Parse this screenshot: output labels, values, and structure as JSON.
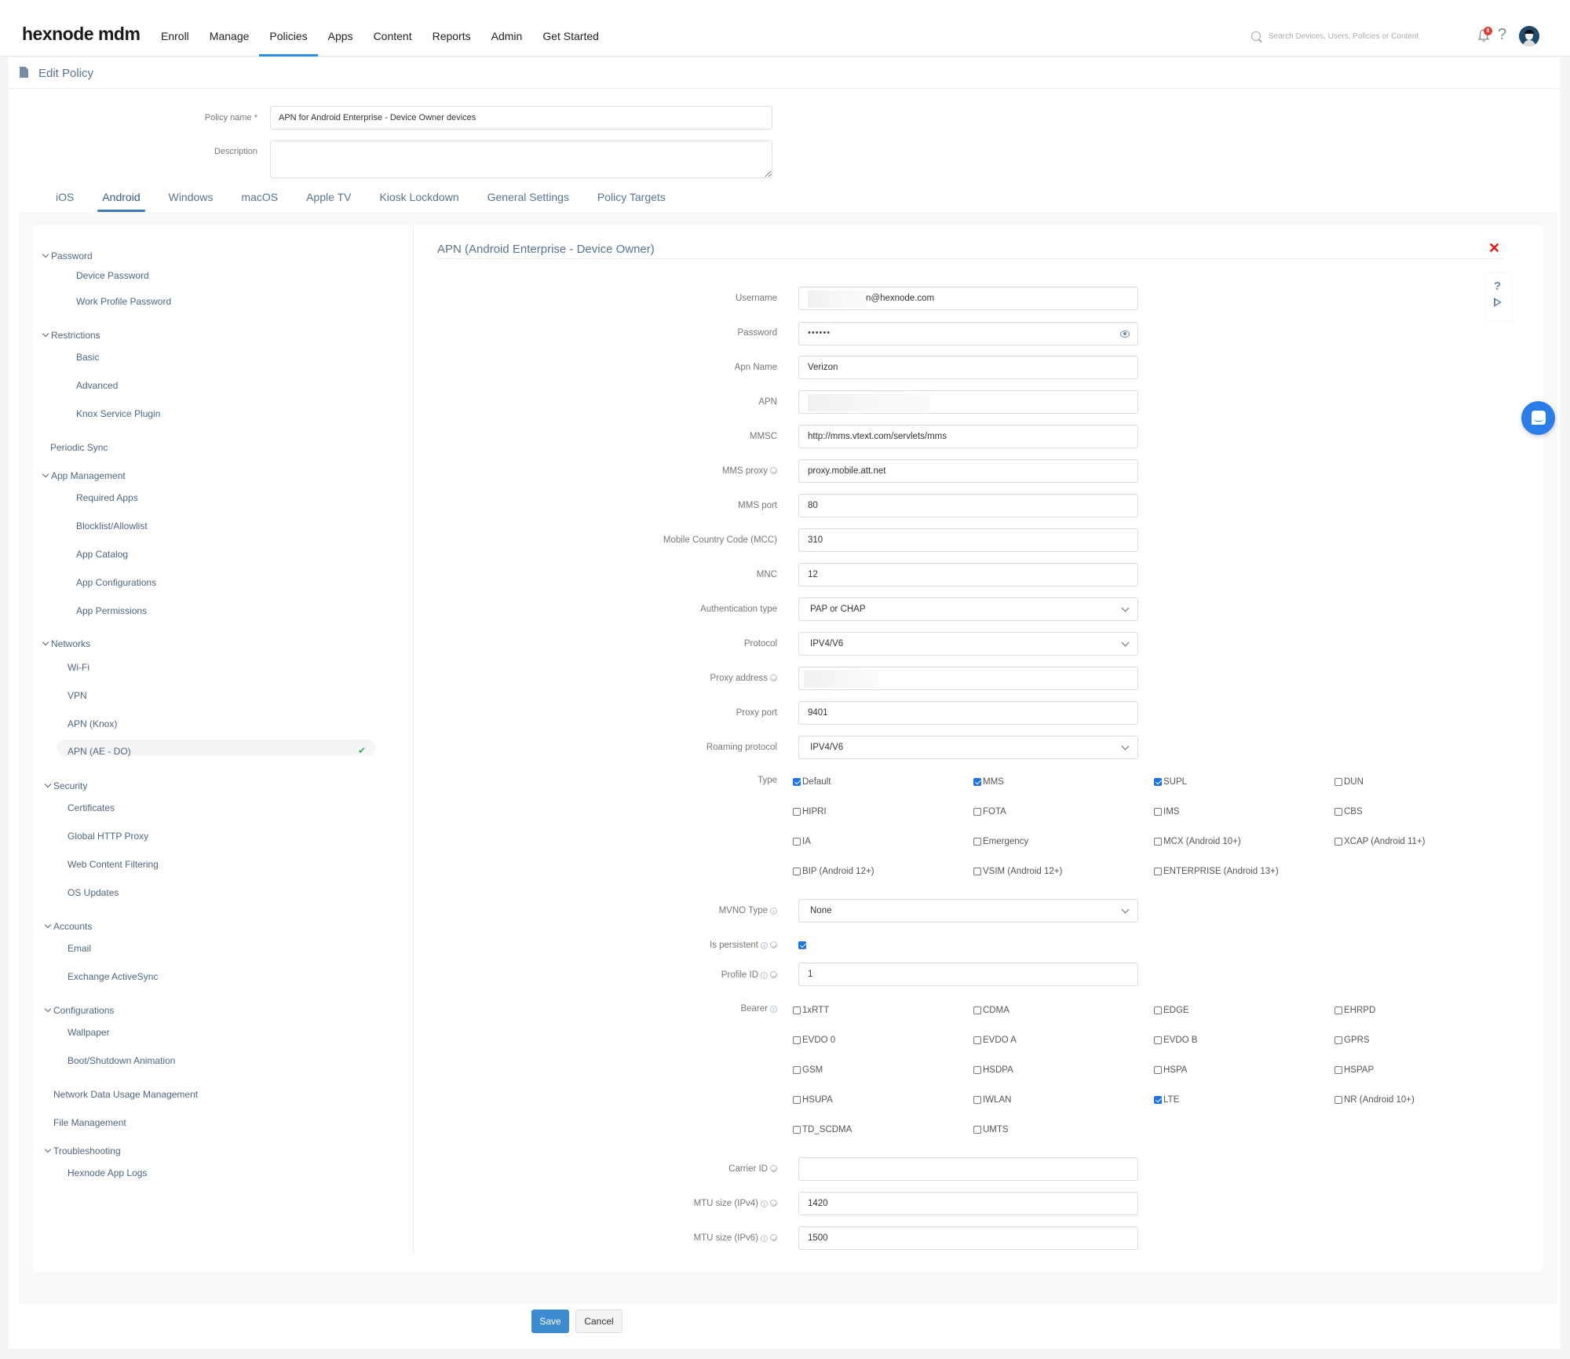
{
  "topbar": {
    "logo": "hexnode mdm",
    "nav": [
      "Enroll",
      "Manage",
      "Policies",
      "Apps",
      "Content",
      "Reports",
      "Admin",
      "Get Started"
    ],
    "active_nav": "Policies",
    "search_placeholder": "Search Devices, Users, Policies or Content",
    "notification_count": "8",
    "help": "?"
  },
  "page": {
    "title": "Edit Policy",
    "policy_name_label": "Policy name *",
    "policy_name_value": "APN for Android Enterprise - Device Owner devices",
    "description_label": "Description",
    "description_value": ""
  },
  "os_tabs": [
    "iOS",
    "Android",
    "Windows",
    "macOS",
    "Apple TV",
    "Kiosk Lockdown",
    "General Settings",
    "Policy Targets"
  ],
  "active_os_tab": "Android",
  "sidebar": {
    "groups": [
      {
        "label": "Password",
        "items": [
          "Device Password",
          "Work Profile Password"
        ]
      },
      {
        "label": "Restrictions",
        "items": [
          "Basic",
          "Advanced",
          "Knox Service Plugin"
        ]
      },
      {
        "label": "Periodic Sync",
        "items": []
      },
      {
        "label": "App Management",
        "items": [
          "Required Apps",
          "Blocklist/Allowlist",
          "App Catalog",
          "App Configurations",
          "App Permissions"
        ]
      },
      {
        "label": "Networks",
        "items": [
          "Wi-Fi",
          "VPN",
          "APN (Knox)",
          "APN (AE - DO)"
        ]
      },
      {
        "label": "Security",
        "items": [
          "Certificates",
          "Global HTTP Proxy",
          "Web Content Filtering",
          "OS Updates"
        ]
      },
      {
        "label": "Accounts",
        "items": [
          "Email",
          "Exchange ActiveSync"
        ]
      },
      {
        "label": "Configurations",
        "items": [
          "Wallpaper",
          "Boot/Shutdown Animation"
        ]
      },
      {
        "label": "Network Data Usage Management",
        "items": []
      },
      {
        "label": "File Management",
        "items": []
      },
      {
        "label": "Troubleshooting",
        "items": [
          "Hexnode App Logs"
        ]
      }
    ],
    "active_item": "APN (AE - DO)"
  },
  "content": {
    "title": "APN (Android Enterprise - Device Owner)",
    "fields": {
      "username": {
        "label": "Username",
        "value": "n@hexnode.com"
      },
      "password": {
        "label": "Password",
        "value": "••••••"
      },
      "apn_name": {
        "label": "Apn Name",
        "value": "Verizon"
      },
      "apn": {
        "label": "APN",
        "value": ""
      },
      "mmsc": {
        "label": "MMSC",
        "value": "http://mms.vtext.com/servlets/mms"
      },
      "mms_proxy": {
        "label": "MMS proxy",
        "value": "proxy.mobile.att.net"
      },
      "mms_port": {
        "label": "MMS port",
        "value": "80"
      },
      "mcc": {
        "label": "Mobile Country Code (MCC)",
        "value": "310"
      },
      "mnc": {
        "label": "MNC",
        "value": "12"
      },
      "auth_type": {
        "label": "Authentication type",
        "value": "PAP or CHAP"
      },
      "protocol": {
        "label": "Protocol",
        "value": "IPV4/V6"
      },
      "proxy_address": {
        "label": "Proxy address",
        "value": ""
      },
      "proxy_port": {
        "label": "Proxy port",
        "value": "9401"
      },
      "roaming_protocol": {
        "label": "Roaming protocol",
        "value": "IPV4/V6"
      },
      "mvno_type": {
        "label": "MVNO Type",
        "value": "None"
      },
      "is_persistent": {
        "label": "Is persistent",
        "checked": true
      },
      "profile_id": {
        "label": "Profile ID",
        "value": "1"
      },
      "carrier_id": {
        "label": "Carrier ID",
        "value": ""
      },
      "mtu_ipv4": {
        "label": "MTU size (IPv4)",
        "value": "1420"
      },
      "mtu_ipv6": {
        "label": "MTU size (IPv6)",
        "value": "1500"
      }
    },
    "type_label": "Type",
    "types": [
      {
        "label": "Default",
        "checked": true
      },
      {
        "label": "MMS",
        "checked": true
      },
      {
        "label": "SUPL",
        "checked": true
      },
      {
        "label": "DUN",
        "checked": false
      },
      {
        "label": "HIPRI",
        "checked": false
      },
      {
        "label": "FOTA",
        "checked": false
      },
      {
        "label": "IMS",
        "checked": false
      },
      {
        "label": "CBS",
        "checked": false
      },
      {
        "label": "IA",
        "checked": false
      },
      {
        "label": "Emergency",
        "checked": false
      },
      {
        "label": "MCX (Android 10+)",
        "checked": false
      },
      {
        "label": "XCAP (Android 11+)",
        "checked": false
      },
      {
        "label": "BIP (Android 12+)",
        "checked": false
      },
      {
        "label": "VSIM (Android 12+)",
        "checked": false
      },
      {
        "label": "ENTERPRISE (Android 13+)",
        "checked": false
      }
    ],
    "bearer_label": "Bearer",
    "bearers": [
      {
        "label": "1xRTT",
        "checked": false
      },
      {
        "label": "CDMA",
        "checked": false
      },
      {
        "label": "EDGE",
        "checked": false
      },
      {
        "label": "EHRPD",
        "checked": false
      },
      {
        "label": "EVDO 0",
        "checked": false
      },
      {
        "label": "EVDO A",
        "checked": false
      },
      {
        "label": "EVDO B",
        "checked": false
      },
      {
        "label": "GPRS",
        "checked": false
      },
      {
        "label": "GSM",
        "checked": false
      },
      {
        "label": "HSDPA",
        "checked": false
      },
      {
        "label": "HSPA",
        "checked": false
      },
      {
        "label": "HSPAP",
        "checked": false
      },
      {
        "label": "HSUPA",
        "checked": false
      },
      {
        "label": "IWLAN",
        "checked": false
      },
      {
        "label": "LTE",
        "checked": true
      },
      {
        "label": "NR (Android 10+)",
        "checked": false
      },
      {
        "label": "TD_SCDMA",
        "checked": false
      },
      {
        "label": "UMTS",
        "checked": false
      }
    ]
  },
  "buttons": {
    "save": "Save",
    "cancel": "Cancel"
  },
  "colors": {
    "accent": "#2d8ee0",
    "save": "#3d8bd0",
    "check": "#1a73e8",
    "close": "#ee1111",
    "ok": "#3cb054"
  }
}
